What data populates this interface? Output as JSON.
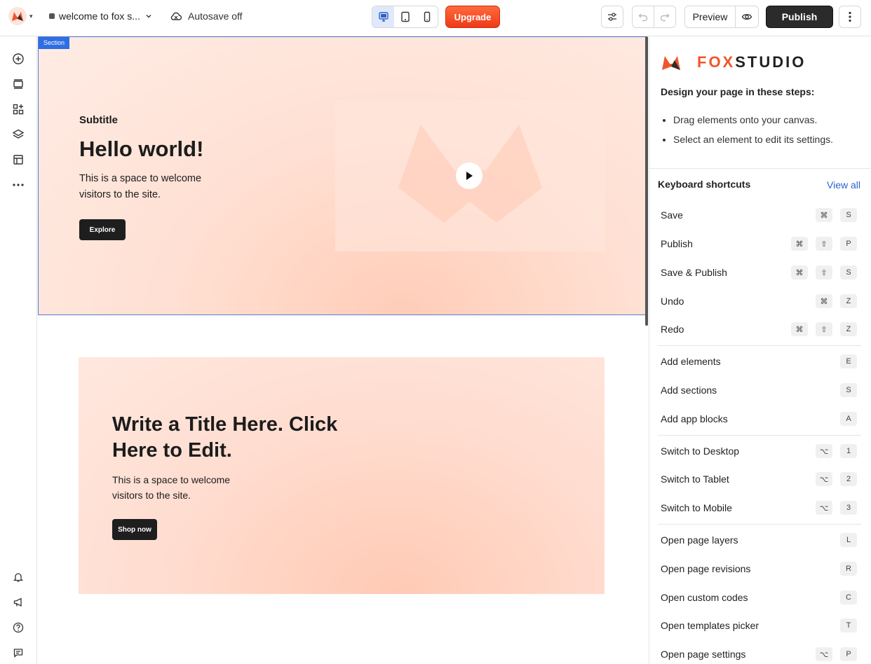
{
  "topbar": {
    "page_name": "welcome to fox s...",
    "autosave": "Autosave off",
    "upgrade": "Upgrade",
    "preview": "Preview",
    "publish": "Publish",
    "active_device": "desktop"
  },
  "canvas": {
    "section_tag": "Section",
    "hero": {
      "subtitle": "Subtitle",
      "title": "Hello world!",
      "text": "This is a space to welcome visitors to the site.",
      "button": "Explore"
    },
    "card": {
      "title": "Write a Title Here. Click Here to Edit.",
      "text": "This is a space to welcome visitors to the site.",
      "button": "Shop now"
    }
  },
  "panel": {
    "brand_fox": "FOX",
    "brand_studio": "STUDIO",
    "steps_title": "Design your page in these steps:",
    "steps": [
      "Drag elements onto your canvas.",
      "Select an element to edit its settings."
    ],
    "shortcuts_title": "Keyboard shortcuts",
    "view_all": "View all",
    "shortcuts": [
      {
        "label": "Save",
        "keys": [
          "⌘",
          "S"
        ]
      },
      {
        "label": "Publish",
        "keys": [
          "⌘",
          "⇧",
          "P"
        ]
      },
      {
        "label": "Save & Publish",
        "keys": [
          "⌘",
          "⇧",
          "S"
        ]
      },
      {
        "label": "Undo",
        "keys": [
          "⌘",
          "Z"
        ]
      },
      {
        "label": "Redo",
        "keys": [
          "⌘",
          "⇧",
          "Z"
        ]
      },
      {
        "label": "Add elements",
        "keys": [
          "E"
        ]
      },
      {
        "label": "Add sections",
        "keys": [
          "S"
        ]
      },
      {
        "label": "Add app blocks",
        "keys": [
          "A"
        ]
      },
      {
        "label": "Switch to Desktop",
        "keys": [
          "⌥",
          "1"
        ]
      },
      {
        "label": "Switch to Tablet",
        "keys": [
          "⌥",
          "2"
        ]
      },
      {
        "label": "Switch to Mobile",
        "keys": [
          "⌥",
          "3"
        ]
      },
      {
        "label": "Open page layers",
        "keys": [
          "L"
        ]
      },
      {
        "label": "Open page revisions",
        "keys": [
          "R"
        ]
      },
      {
        "label": "Open custom codes",
        "keys": [
          "C"
        ]
      },
      {
        "label": "Open templates picker",
        "keys": [
          "T"
        ]
      },
      {
        "label": "Open page settings",
        "keys": [
          "⌥",
          "P"
        ]
      }
    ]
  },
  "colors": {
    "accent": "#f0552c",
    "selection": "#2f6fe4",
    "hero_bg": "#ffe0d3"
  }
}
